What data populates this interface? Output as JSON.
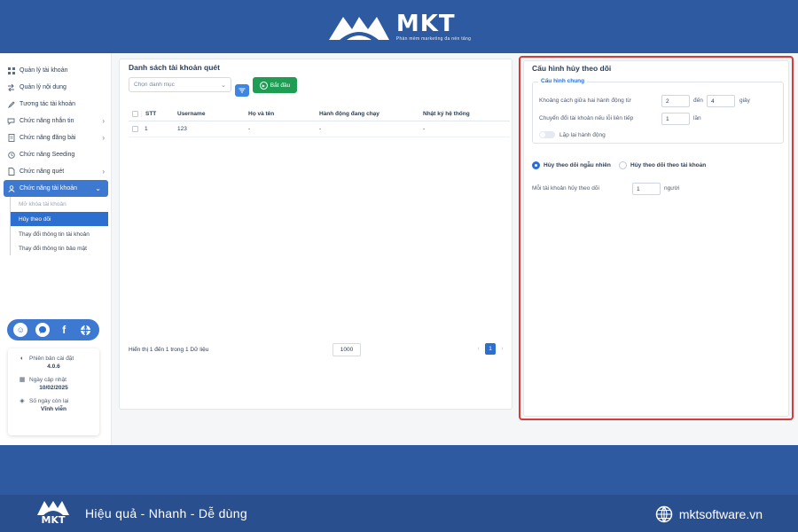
{
  "header": {
    "brand_name": "MKT",
    "brand_tagline": "Phần mềm marketing đa nền tảng"
  },
  "sidebar": {
    "items": [
      {
        "label": "Quản lý tài khoản",
        "icon": "grid-icon"
      },
      {
        "label": "Quản lý nội dung",
        "icon": "swap-icon"
      },
      {
        "label": "Tương tác tài khoản",
        "icon": "edit-icon"
      },
      {
        "label": "Chức năng nhắn tin",
        "icon": "chat-icon"
      },
      {
        "label": "Chức năng đăng bài",
        "icon": "document-icon"
      },
      {
        "label": "Chức năng Seeding",
        "icon": "seeding-icon"
      },
      {
        "label": "Chức năng quét",
        "icon": "scan-icon"
      },
      {
        "label": "Chức năng tài khoản",
        "icon": "user-icon"
      }
    ],
    "submenu": [
      "Mở khóa tài khoản",
      "Hủy theo dõi",
      "Thay đổi thông tin tài khoản",
      "Thay đổi thông tin bảo mật"
    ],
    "info": {
      "version_label": "Phiên bản cài đặt",
      "version_value": "4.0.6",
      "update_label": "Ngày cập nhật",
      "update_value": "10/02/2025",
      "days_label": "Số ngày còn lại",
      "days_value": "Vĩnh viễn"
    }
  },
  "scan_panel": {
    "title": "Danh sách tài khoản quét",
    "select_placeholder": "Chọn danh mục",
    "start_label": "Bắt đầu",
    "columns": [
      "STT",
      "Username",
      "Họ và tên",
      "Hành động đang chạy",
      "Nhật ký hệ thống"
    ],
    "rows": [
      {
        "stt": "1",
        "username": "123",
        "name": "-",
        "action": "-",
        "log": "-"
      }
    ],
    "footer_text": "Hiển thị 1 đến 1 trong 1 Dữ liệu",
    "page_size": "1000",
    "current_page": "1",
    "prev_arrow": "‹",
    "next_arrow": "›"
  },
  "config_panel": {
    "title": "Cấu hình hủy theo dõi",
    "general_legend": "Cấu hình chung",
    "delay_label": "Khoảng cách giữa hai hành động từ",
    "delay_from": "2",
    "delay_to_label": "đến",
    "delay_to": "4",
    "delay_unit": "giây",
    "switch_label": "Chuyển đổi tài khoản nếu lỗi liên tiếp",
    "switch_value": "1",
    "switch_unit": "lần",
    "repeat_label": "Lặp lại hành động",
    "radio_random": "Hủy theo dõi ngẫu nhiên",
    "radio_by_account": "Hủy theo dõi theo tài khoản",
    "per_account_label": "Mỗi tài khoản hủy theo dõi",
    "per_account_value": "1",
    "per_account_unit": "người"
  },
  "footer": {
    "logo_text": "MKT",
    "slogan": "Hiệu quả - Nhanh - Dễ dùng",
    "website": "mktsoftware.vn"
  },
  "colors": {
    "brand_blue": "#2d5aa0",
    "active_blue": "#3d79d0",
    "start_green": "#1f9d55",
    "highlight_red": "#d43b3b"
  }
}
